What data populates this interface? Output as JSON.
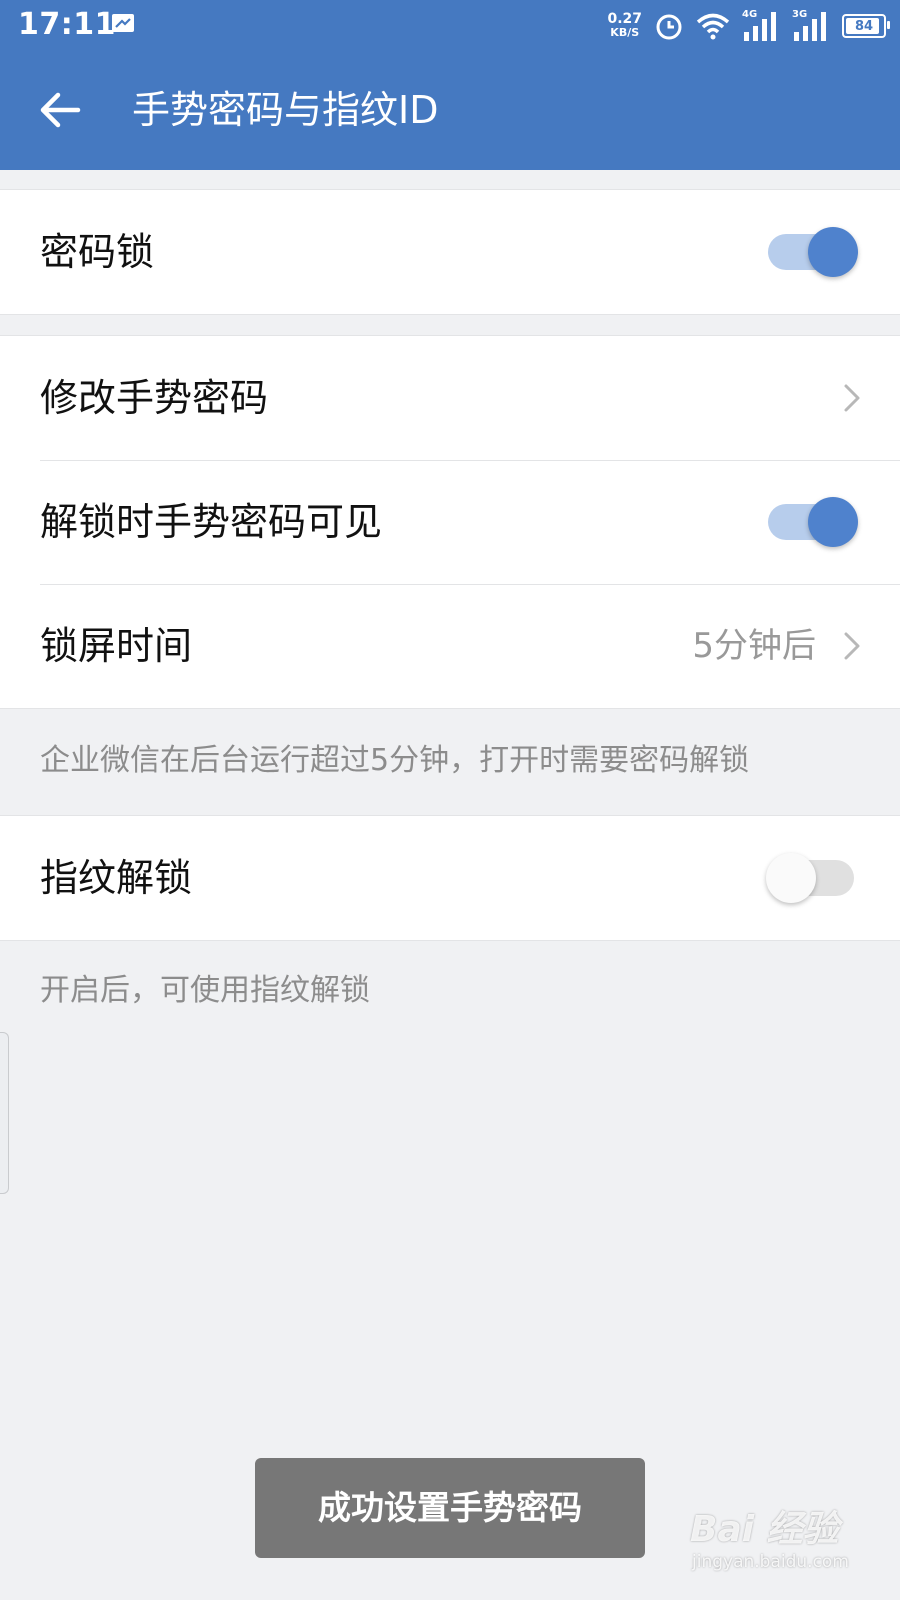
{
  "status_bar": {
    "time": "17:11",
    "net_speed_value": "0.27",
    "net_speed_unit": "KB/S",
    "signal_1_label": "4G",
    "signal_2_label": "3G",
    "battery": "84"
  },
  "app_bar": {
    "title": "手势密码与指纹ID"
  },
  "settings": {
    "password_lock": {
      "label": "密码锁",
      "enabled": true
    },
    "change_gesture": {
      "label": "修改手势密码"
    },
    "gesture_visible": {
      "label": "解锁时手势密码可见",
      "enabled": true
    },
    "lock_time": {
      "label": "锁屏时间",
      "value": "5分钟后"
    },
    "lock_time_note": "企业微信在后台运行超过5分钟，打开时需要密码解锁",
    "fingerprint": {
      "label": "指纹解锁",
      "enabled": false
    },
    "fingerprint_note": "开启后，可使用指纹解锁"
  },
  "toast": {
    "message": "成功设置手势密码"
  },
  "watermark": {
    "main": "Bai 经验",
    "sub": "jingyan.baidu.com"
  },
  "colors": {
    "primary": "#4579c1",
    "switch_on": "#4f82cd",
    "background": "#f0f1f3"
  }
}
